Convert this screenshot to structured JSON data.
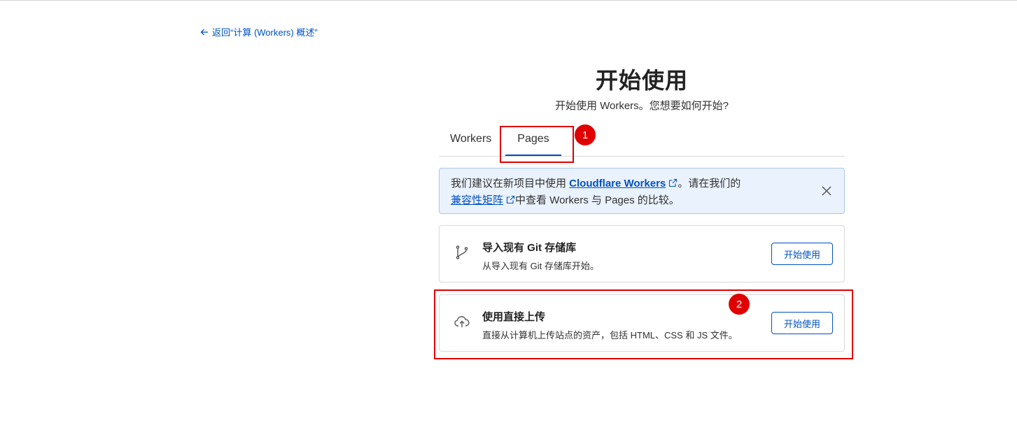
{
  "back_link": {
    "text": "返回“计算 (Workers) 概述”",
    "icon": "arrow-left-icon"
  },
  "header": {
    "title": "开始使用",
    "subtitle": "开始使用 Workers。您想要如何开始?"
  },
  "tabs": [
    {
      "label": "Workers",
      "active": false
    },
    {
      "label": "Pages",
      "active": true
    }
  ],
  "banner": {
    "text_1": "我们建议在新项目中使用 ",
    "link_1": "Cloudflare Workers",
    "text_2": "。请在我们的",
    "link_2": "兼容性矩阵",
    "text_3": "中查看 Workers 与 Pages 的比较。",
    "close_icon": "close-icon",
    "external_icon": "external-link-icon"
  },
  "options": [
    {
      "icon": "git-branch-icon",
      "title": "导入现有 Git 存储库",
      "description": "从导入现有 Git 存储库开始。",
      "button": "开始使用"
    },
    {
      "icon": "cloud-upload-icon",
      "title": "使用直接上传",
      "description": "直接从计算机上传站点的资产，包括 HTML、CSS 和 JS 文件。",
      "button": "开始使用"
    }
  ],
  "annotations": [
    {
      "number": "1"
    },
    {
      "number": "2"
    }
  ],
  "colors": {
    "accent": "#0051c3",
    "annotation": "#e00000",
    "banner_bg": "#eaf2fd"
  }
}
